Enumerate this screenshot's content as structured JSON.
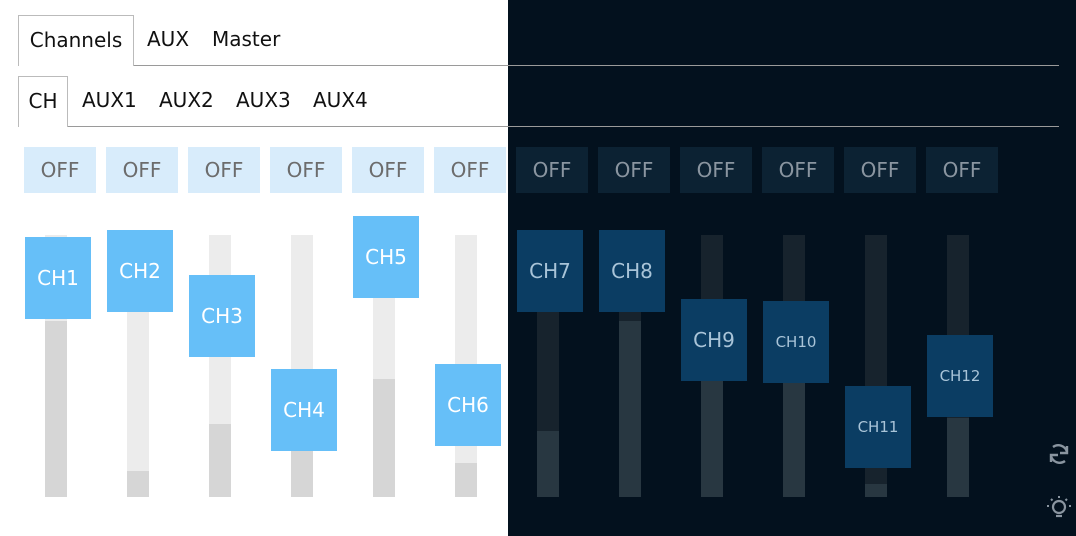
{
  "tabs": [
    {
      "label": "Channels",
      "active": true
    },
    {
      "label": "AUX",
      "active": false
    },
    {
      "label": "Master",
      "active": false
    }
  ],
  "subtabs": [
    {
      "label": "CH",
      "active": true
    },
    {
      "label": "AUX1",
      "active": false
    },
    {
      "label": "AUX2",
      "active": false
    },
    {
      "label": "AUX3",
      "active": false
    },
    {
      "label": "AUX4",
      "active": false
    }
  ],
  "channels": [
    {
      "name": "CH1",
      "mute_label": "OFF",
      "level": 0.67
    },
    {
      "name": "CH2",
      "mute_label": "OFF",
      "level": 0.1
    },
    {
      "name": "CH3",
      "mute_label": "OFF",
      "level": 0.28
    },
    {
      "name": "CH4",
      "mute_label": "OFF",
      "level": 0.18
    },
    {
      "name": "CH5",
      "mute_label": "OFF",
      "level": 0.45
    },
    {
      "name": "CH6",
      "mute_label": "OFF",
      "level": 0.13
    },
    {
      "name": "CH7",
      "mute_label": "OFF",
      "level": 0.25
    },
    {
      "name": "CH8",
      "mute_label": "OFF",
      "level": 0.67
    },
    {
      "name": "CH9",
      "mute_label": "OFF",
      "level": 0.45
    },
    {
      "name": "CH10",
      "mute_label": "OFF",
      "level": 0.44
    },
    {
      "name": "CH11",
      "mute_label": "OFF",
      "level": 0.05
    },
    {
      "name": "CH12",
      "mute_label": "OFF",
      "level": 0.3
    }
  ],
  "colors": {
    "light_background": "#ffffff",
    "dark_background": "#03111e",
    "light_knob": "#66bff8",
    "dark_knob": "#0b3d63",
    "light_off_button": "#d8ecfb",
    "dark_off_button": "#0c2233"
  },
  "icons": [
    "refresh-icon",
    "lightbulb-icon"
  ]
}
